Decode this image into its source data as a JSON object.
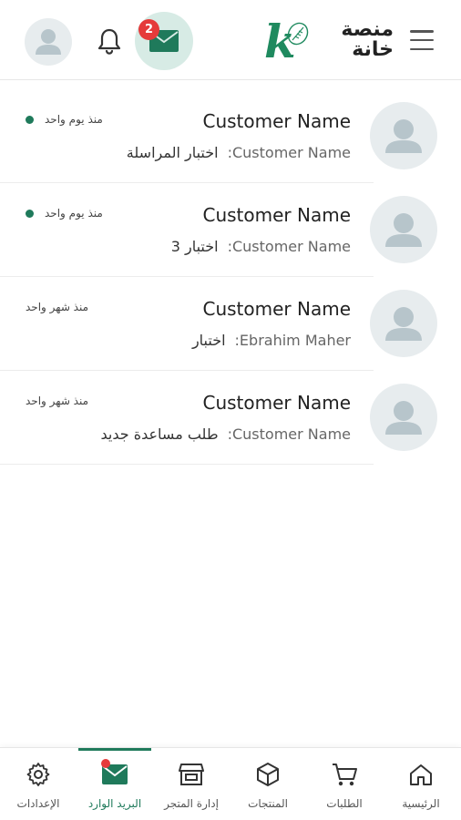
{
  "colors": {
    "accent": "#1f7a5b",
    "badge": "#e53b3b",
    "avatar_bg": "#e7ecee",
    "avatar_fg": "#b7c5cb",
    "mail_active_bg": "#d7ebe5",
    "unread_dot": "#1f7a5b"
  },
  "header": {
    "logo_letter": "k",
    "logo_text_line1": "منصة",
    "logo_text_line2": "خانة",
    "mail_badge_count": "2",
    "icons": [
      "user-avatar-icon",
      "bell-icon",
      "mail-icon",
      "menu-icon"
    ]
  },
  "messages": [
    {
      "name": "Customer Name",
      "sender": "Customer Name",
      "subject": "اختبار المراسلة",
      "time": "منذ يوم واحد",
      "unread": true
    },
    {
      "name": "Customer Name",
      "sender": "Customer Name",
      "subject": "اختبار 3",
      "time": "منذ يوم واحد",
      "unread": true
    },
    {
      "name": "Customer Name",
      "sender": "Ebrahim Maher",
      "subject": "اختبار",
      "time": "منذ شهر واحد",
      "unread": false
    },
    {
      "name": "Customer Name",
      "sender": "Customer Name",
      "subject": "طلب مساعدة جديد",
      "time": "منذ شهر واحد",
      "unread": false
    }
  ],
  "sender_suffix": ":",
  "bottom_nav": [
    {
      "label": "الرئيسية",
      "icon": "home-icon",
      "active": false
    },
    {
      "label": "الطلبات",
      "icon": "cart-icon",
      "active": false
    },
    {
      "label": "المنتجات",
      "icon": "box-icon",
      "active": false
    },
    {
      "label": "إدارة المتجر",
      "icon": "store-icon",
      "active": false
    },
    {
      "label": "البريد الوارد",
      "icon": "mail-icon",
      "active": true
    },
    {
      "label": "الإعدادات",
      "icon": "gear-icon",
      "active": false
    }
  ]
}
